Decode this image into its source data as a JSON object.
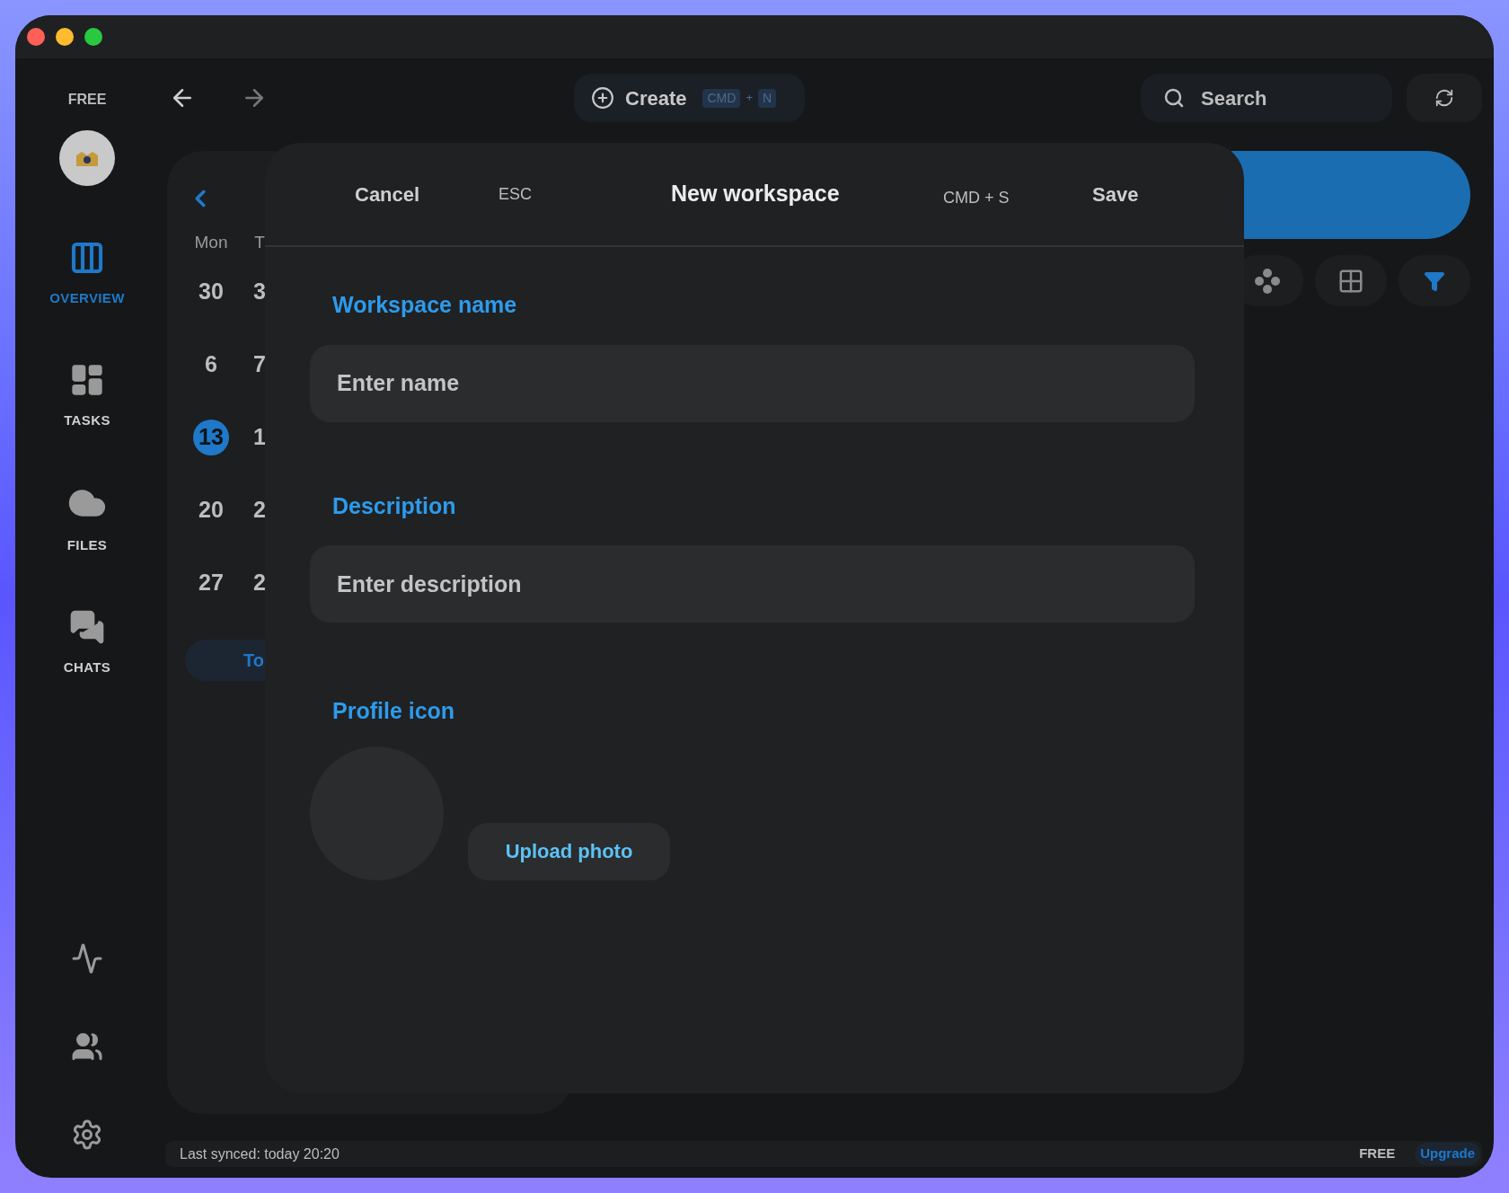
{
  "sidebar": {
    "plan": "FREE",
    "items": [
      {
        "kind": "overview",
        "label": "OVERVIEW",
        "selected": true
      },
      {
        "kind": "tasks",
        "label": "TASKS",
        "selected": false
      },
      {
        "kind": "files",
        "label": "FILES",
        "selected": false
      },
      {
        "kind": "chats",
        "label": "CHATS",
        "selected": false
      }
    ],
    "bottom_items": [
      {
        "kind": "analytics"
      },
      {
        "kind": "team"
      },
      {
        "kind": "settings"
      }
    ]
  },
  "toolbar": {
    "create": {
      "label": "Create",
      "keys": [
        "CMD",
        "+",
        "N"
      ]
    },
    "search": {
      "placeholder": "Search"
    }
  },
  "calendar": {
    "weekdays": [
      "Mon",
      "T"
    ],
    "weeks": [
      [
        {
          "day": "30",
          "selected": false
        },
        {
          "day": "3",
          "selected": false
        }
      ],
      [
        {
          "day": "6",
          "selected": false
        },
        {
          "day": "7",
          "selected": false
        }
      ],
      [
        {
          "day": "13",
          "selected": true
        },
        {
          "day": "1",
          "selected": false
        }
      ],
      [
        {
          "day": "20",
          "selected": false
        },
        {
          "day": "2",
          "selected": false
        }
      ],
      [
        {
          "day": "27",
          "selected": false
        },
        {
          "day": "2",
          "selected": false
        }
      ]
    ],
    "today_button": "To"
  },
  "dialog": {
    "cancel": "Cancel",
    "cancel_shortcut": "ESC",
    "title": "New workspace",
    "save_shortcut": "CMD + S",
    "save": "Save",
    "fields": [
      {
        "label": "Workspace name",
        "placeholder": "Enter name"
      },
      {
        "label": "Description",
        "placeholder": "Enter description"
      }
    ],
    "profile_icon": {
      "label": "Profile icon",
      "button": "Upload photo"
    }
  },
  "status_bar": {
    "sync": "Last synced: today 20:20",
    "plan": "FREE",
    "upgrade": "Upgrade"
  }
}
